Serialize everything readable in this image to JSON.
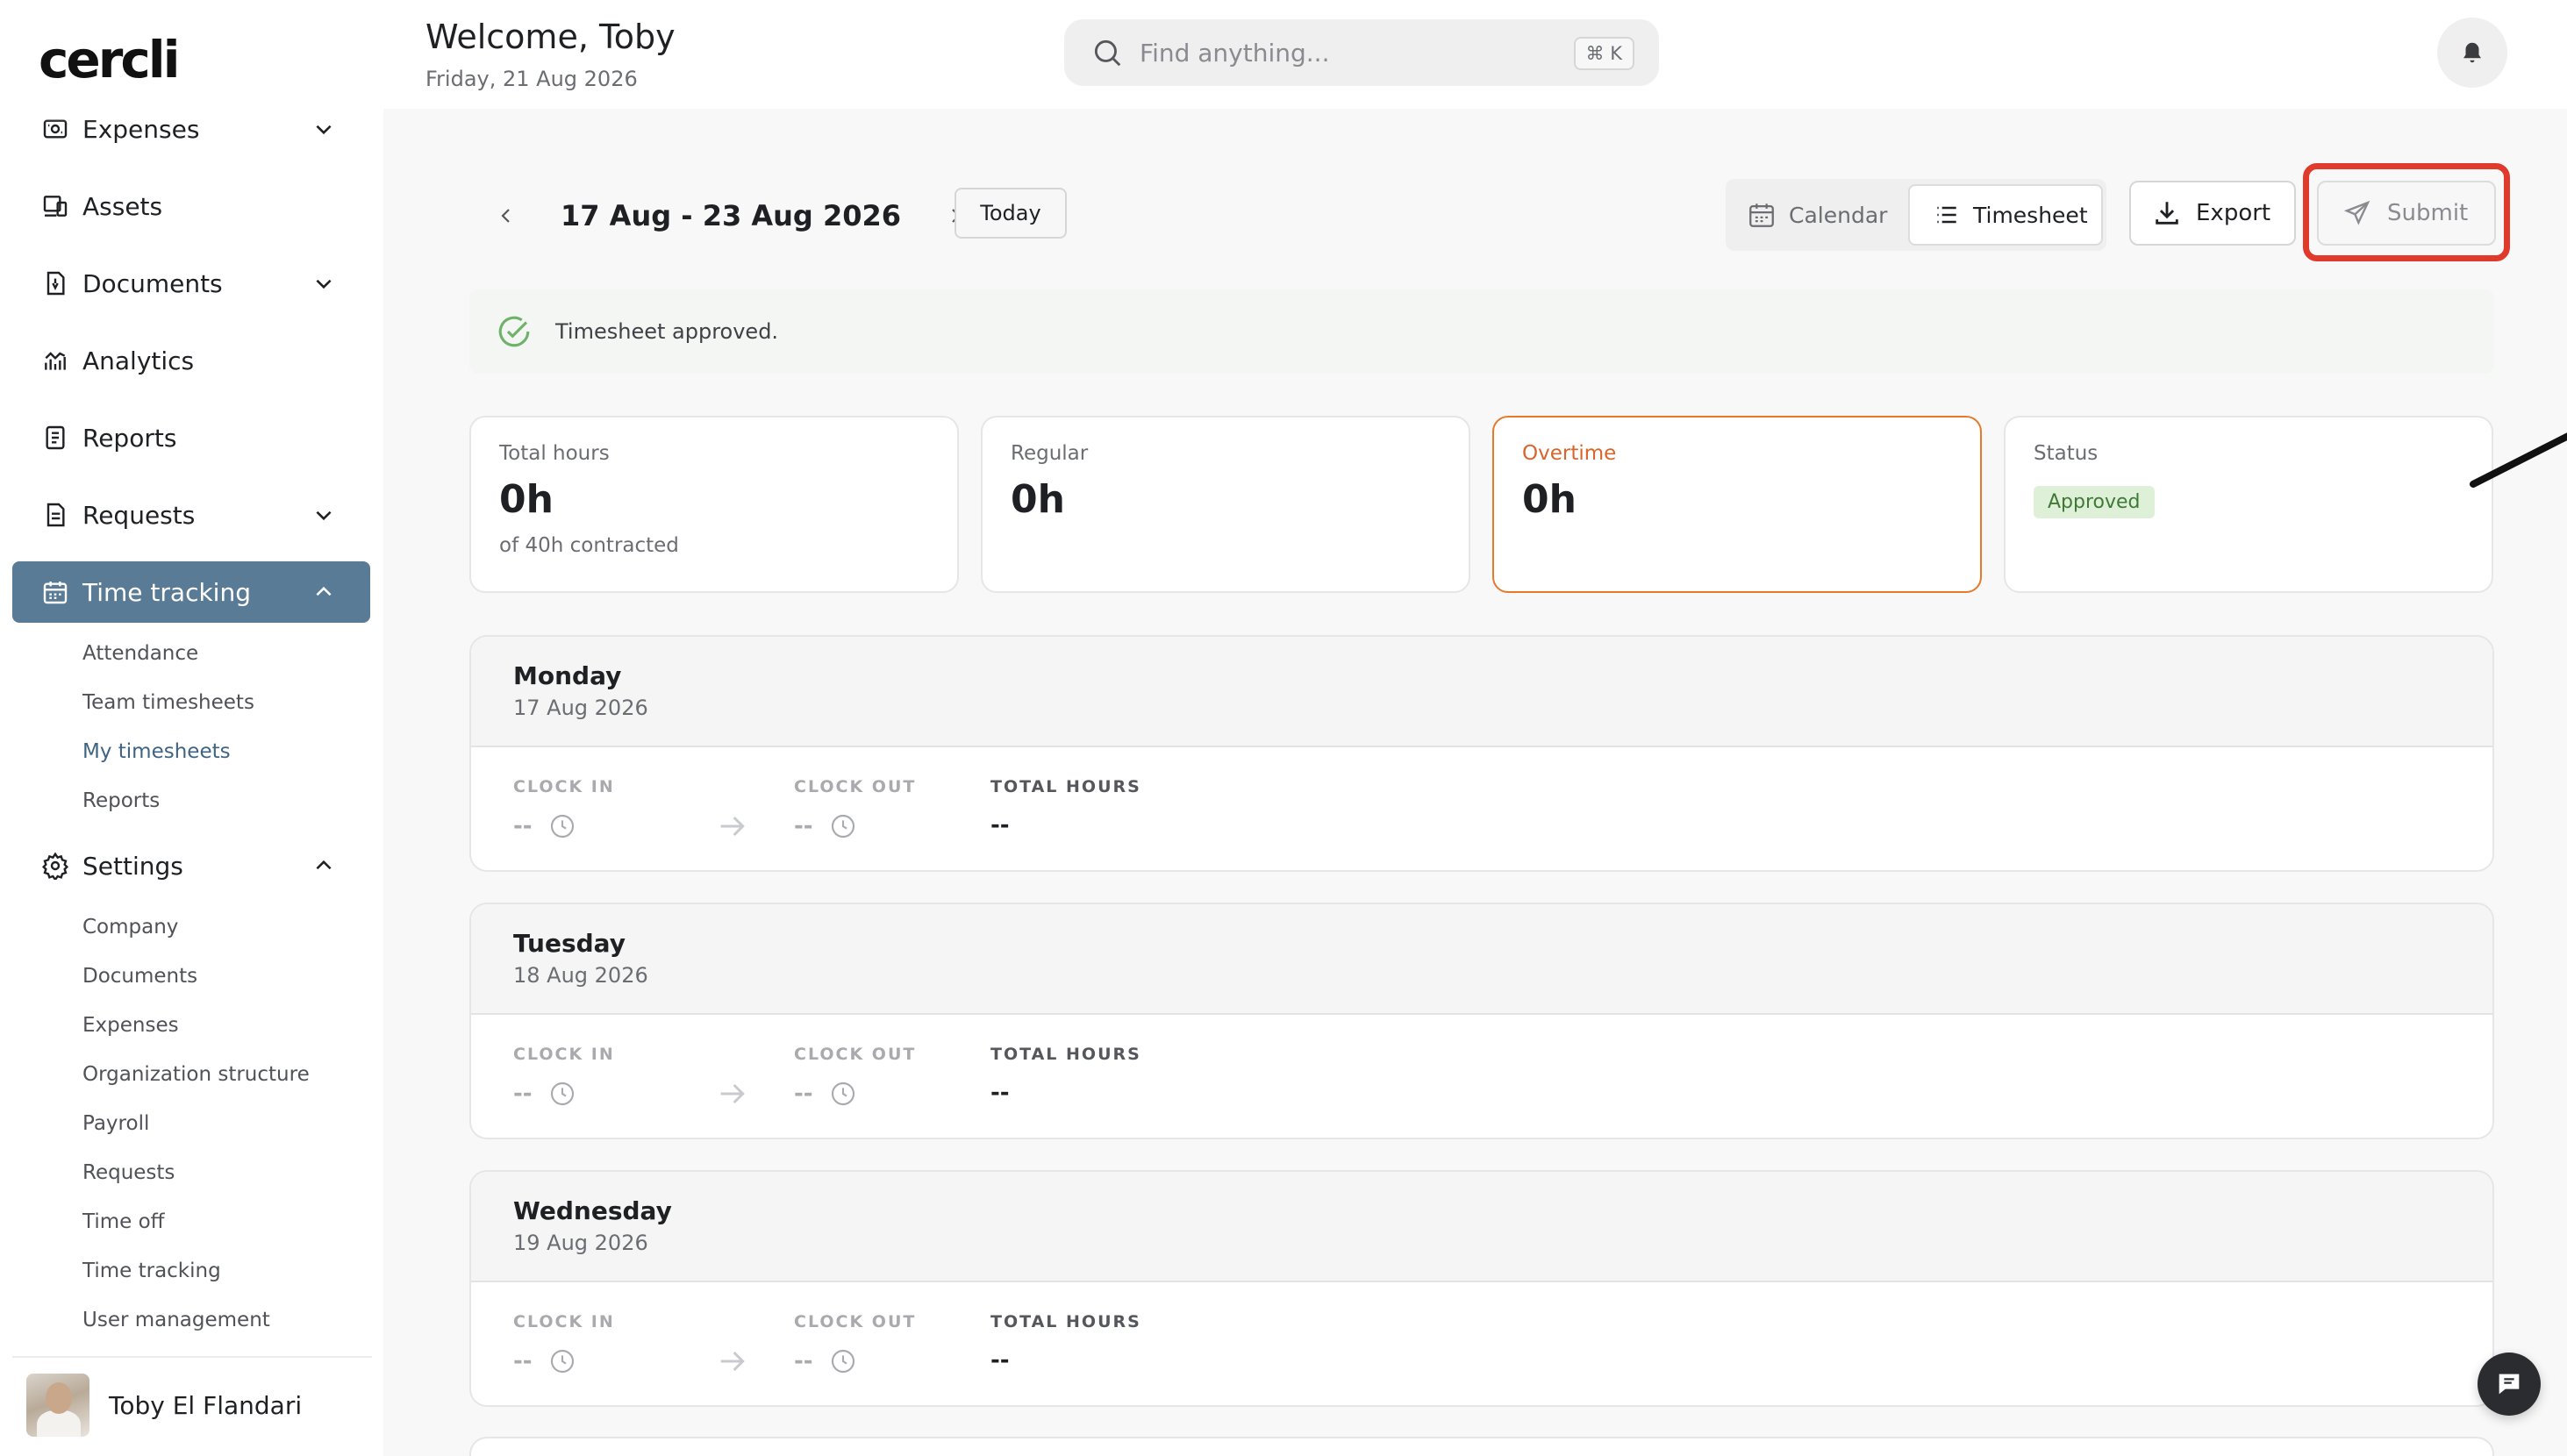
{
  "app": {
    "logo_text": "cercli"
  },
  "header": {
    "welcome": "Welcome, Toby",
    "date": "Friday, 21 Aug 2026",
    "search_placeholder": "Find anything...",
    "search_shortcut": "⌘ K"
  },
  "sidebar": {
    "items": [
      {
        "label": "Expenses",
        "icon": "receipt-icon",
        "expandable": true,
        "expanded": false
      },
      {
        "label": "Assets",
        "icon": "devices-icon",
        "expandable": false
      },
      {
        "label": "Documents",
        "icon": "document-icon",
        "expandable": true,
        "expanded": false
      },
      {
        "label": "Analytics",
        "icon": "analytics-icon",
        "expandable": false
      },
      {
        "label": "Reports",
        "icon": "report-icon",
        "expandable": false
      },
      {
        "label": "Requests",
        "icon": "requests-icon",
        "expandable": true,
        "expanded": false
      },
      {
        "label": "Time tracking",
        "icon": "calendar-icon",
        "expandable": true,
        "expanded": true,
        "active": true
      },
      {
        "label": "Settings",
        "icon": "gear-icon",
        "expandable": true,
        "expanded": true
      }
    ],
    "time_tracking_sub": [
      "Attendance",
      "Team timesheets",
      "My timesheets",
      "Reports"
    ],
    "time_tracking_selected": "My timesheets",
    "settings_sub": [
      "Company",
      "Documents",
      "Expenses",
      "Organization structure",
      "Payroll",
      "Requests",
      "Time off",
      "Time tracking",
      "User management"
    ],
    "user_name": "Toby El Flandari"
  },
  "toolbar": {
    "week_label": "17 Aug - 23 Aug 2026",
    "today_label": "Today",
    "calendar_label": "Calendar",
    "timesheet_label": "Timesheet",
    "export_label": "Export",
    "submit_label": "Submit"
  },
  "banner": {
    "text": "Timesheet approved."
  },
  "summary": {
    "total_label": "Total hours",
    "total_value": "0h",
    "total_sub": "of 40h contracted",
    "regular_label": "Regular",
    "regular_value": "0h",
    "overtime_label": "Overtime",
    "overtime_value": "0h",
    "status_label": "Status",
    "status_value": "Approved"
  },
  "columns": {
    "clock_in": "CLOCK IN",
    "clock_out": "CLOCK OUT",
    "total_hours": "TOTAL HOURS"
  },
  "days": [
    {
      "name": "Monday",
      "date": "17 Aug 2026",
      "clock_in": "--",
      "clock_out": "--",
      "total": "--"
    },
    {
      "name": "Tuesday",
      "date": "18 Aug 2026",
      "clock_in": "--",
      "clock_out": "--",
      "total": "--"
    },
    {
      "name": "Wednesday",
      "date": "19 Aug 2026",
      "clock_in": "--",
      "clock_out": "--",
      "total": "--"
    }
  ],
  "colors": {
    "accent": "#5a7b96",
    "overtime": "#e6792a",
    "highlight": "#e03a2d",
    "approved_bg": "#dff0d9",
    "approved_text": "#3e7a35"
  }
}
